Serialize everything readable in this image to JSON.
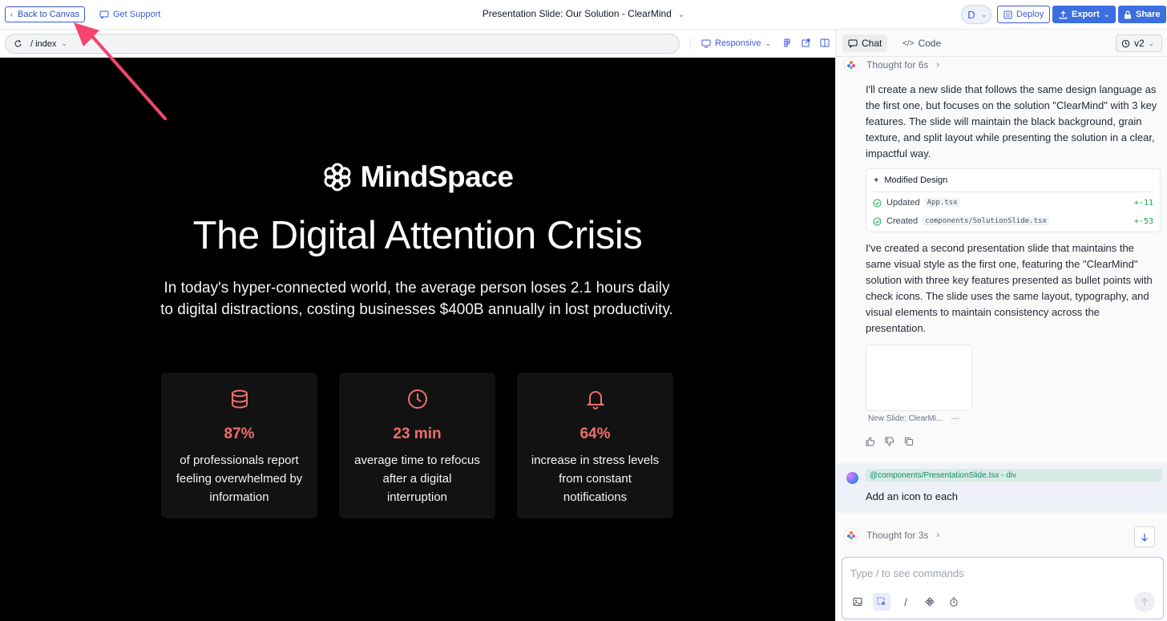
{
  "topbar": {
    "back_label": "Back to Canvas",
    "support_label": "Get Support",
    "title": "Presentation Slide: Our Solution - ClearMind",
    "avatar_initial": "D",
    "deploy_label": "Deploy",
    "export_label": "Export",
    "share_label": "Share"
  },
  "preview": {
    "path": "/ index",
    "responsive_label": "Responsive"
  },
  "slide": {
    "brand": "MindSpace",
    "title": "The Digital Attention Crisis",
    "subtitle": "In today's hyper-connected world, the average person loses 2.1 hours daily to digital distractions, costing businesses $400B annually in lost productivity.",
    "stats": [
      {
        "icon": "database-icon",
        "value": "87%",
        "desc": "of professionals report feeling overwhelmed by information"
      },
      {
        "icon": "clock-icon",
        "value": "23 min",
        "desc": "average time to refocus after a digital interruption"
      },
      {
        "icon": "bell-icon",
        "value": "64%",
        "desc": "increase in stress levels from constant notifications"
      }
    ],
    "accent_color": "#f26d6d"
  },
  "panel": {
    "tab_chat": "Chat",
    "tab_code": "Code",
    "version": "v2",
    "thought1": "Thought for 6s",
    "msg1": "I'll create a new slide that follows the same design language as the first one, but focuses on the solution \"ClearMind\" with 3 key features. The slide will maintain the black background, grain texture, and split layout while presenting the solution in a clear, impactful way.",
    "modified": {
      "title": "Modified Design",
      "rows": [
        {
          "action": "Updated",
          "file": "App.tsx",
          "diff": "+-11"
        },
        {
          "action": "Created",
          "file": "components/SolutionSlide.tsx",
          "diff": "+-53"
        }
      ]
    },
    "msg2": "I've created a second presentation slide that maintains the same visual style as the first one, featuring the \"ClearMind\" solution with three key features presented as bullet points with check icons. The slide uses the same layout, typography, and visual elements to maintain consistency across the presentation.",
    "thumb_caption": "New Slide: ClearMi...",
    "thumb_more": "···",
    "user_mention": "@components/PresentationSlide.tsx - div",
    "user_text": "Add an icon to each",
    "thought2": "Thought for 3s",
    "composer_placeholder": "Type / to see commands"
  }
}
